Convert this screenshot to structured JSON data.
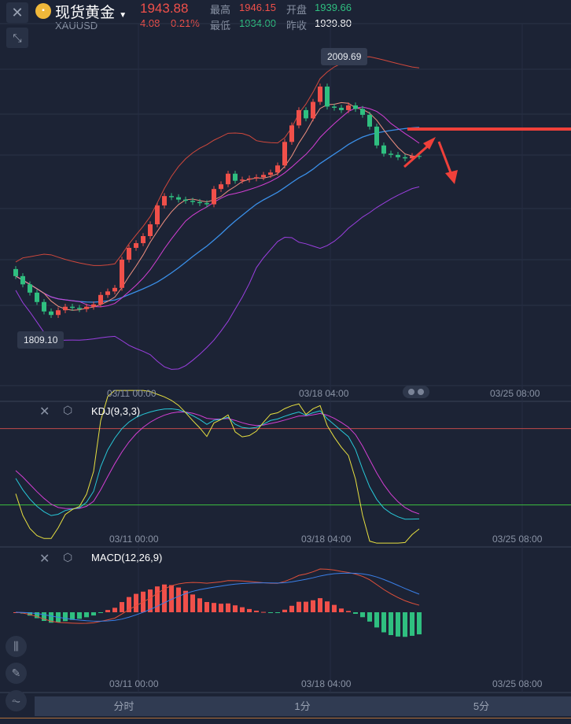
{
  "header": {
    "title": "现货黄金",
    "symbol": "XAUUSD",
    "price": "1943.88",
    "change": "4.08",
    "change_pct": "0.21%",
    "high_label": "最高",
    "high": "1946.15",
    "low_label": "最低",
    "low": "1934.00",
    "open_label": "开盘",
    "open": "1939.66",
    "prev_label": "昨收",
    "prev_close": "1939.80"
  },
  "main_chart": {
    "max_label": "2009.69",
    "min_label": "1809.10",
    "x_labels": [
      "03/11 00:00",
      "03/18 04:00",
      "03/25 08:00"
    ]
  },
  "kdj": {
    "title": "KDJ(9,3,3)",
    "x_labels": [
      "03/11 00:00",
      "03/18 04:00",
      "03/25 08:00"
    ]
  },
  "macd": {
    "title": "MACD(12,26,9)",
    "x_labels": [
      "03/11 00:00",
      "03/18 04:00",
      "03/25 08:00"
    ]
  },
  "tabs": [
    "分时",
    "1分",
    "5分"
  ],
  "colors": {
    "up": "#f0504a",
    "down": "#2fbf80",
    "bg": "#1c2335"
  },
  "chart_data": {
    "type": "candlestick",
    "first_open": 1848,
    "closes": [
      1842,
      1835,
      1828,
      1820,
      1812,
      1809,
      1813,
      1816,
      1815,
      1814,
      1816,
      1818,
      1826,
      1829,
      1832,
      1856,
      1866,
      1870,
      1876,
      1886,
      1902,
      1910,
      1909,
      1907,
      1906,
      1905,
      1904,
      1903,
      1916,
      1920,
      1929,
      1923,
      1924,
      1925,
      1926,
      1928,
      1930,
      1936,
      1956,
      1970,
      1983,
      1976,
      1990,
      2003,
      1986,
      1985,
      1983,
      1987,
      1984,
      1979,
      1969,
      1953,
      1946,
      1945,
      1943,
      1942,
      1944,
      1943.88
    ]
  }
}
